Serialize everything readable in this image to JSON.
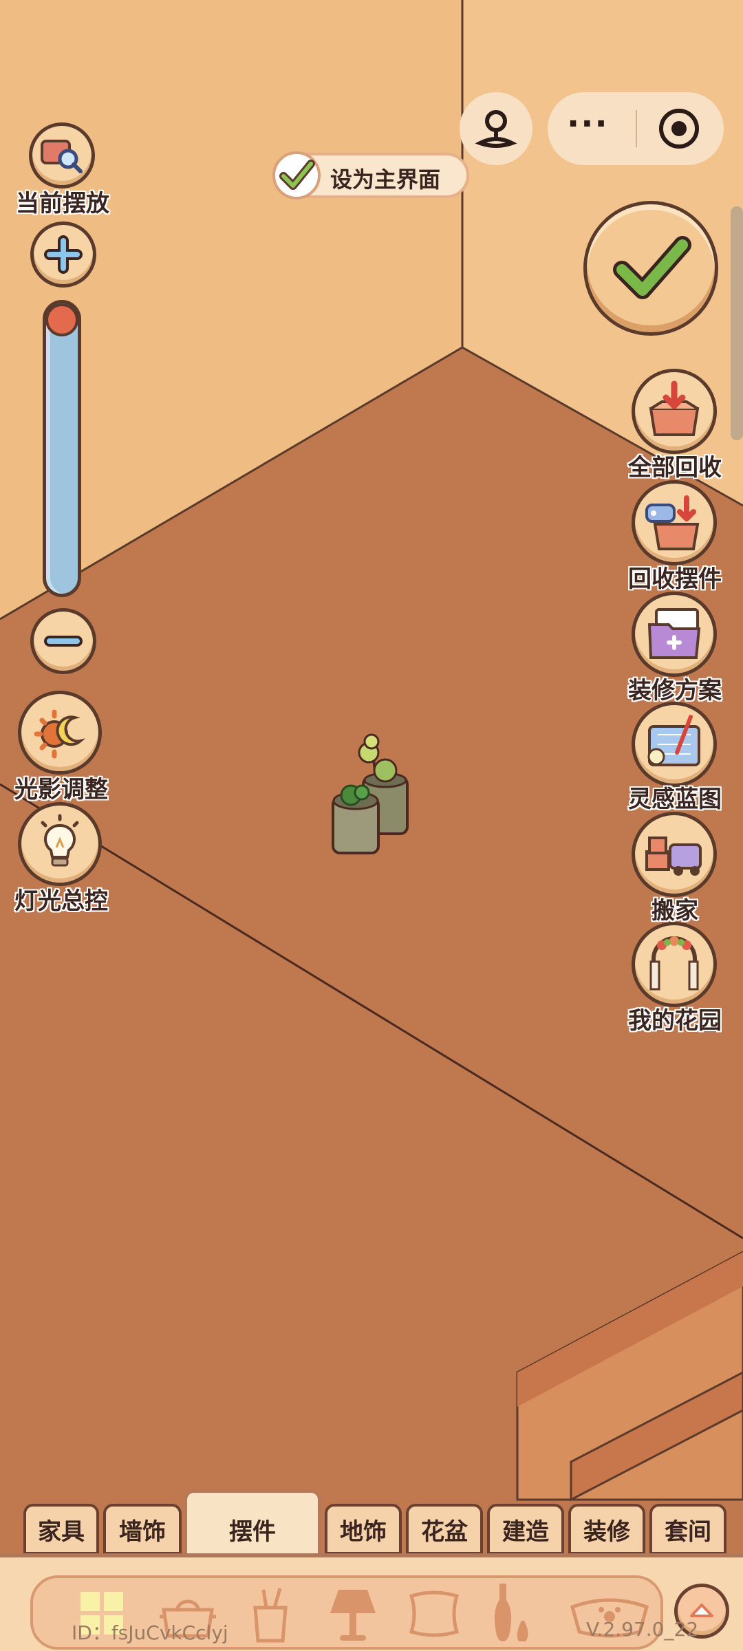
{
  "top": {
    "set_main_label": "设为主界面",
    "more_glyph": "···"
  },
  "left_tools": {
    "current_placement": "当前摆放",
    "lighting_shadow": "光影调整",
    "light_control": "灯光总控",
    "zoom_level": 0.0
  },
  "right_tools": [
    {
      "label": "全部回收",
      "icon": "box-arrow-down-icon"
    },
    {
      "label": "回收摆件",
      "icon": "box-tag-icon"
    },
    {
      "label": "装修方案",
      "icon": "folder-plus-icon"
    },
    {
      "label": "灵感蓝图",
      "icon": "blueprint-icon"
    },
    {
      "label": "搬家",
      "icon": "moving-truck-icon"
    },
    {
      "label": "我的花园",
      "icon": "garden-arch-icon"
    }
  ],
  "tabs": [
    {
      "label": "家具",
      "active": false
    },
    {
      "label": "墙饰",
      "active": false
    },
    {
      "label": "摆件",
      "active": true
    },
    {
      "label": "地饰",
      "active": false
    },
    {
      "label": "花盆",
      "active": false
    },
    {
      "label": "建造",
      "active": false
    },
    {
      "label": "装修",
      "active": false
    },
    {
      "label": "套间",
      "active": false
    }
  ],
  "category_icons": [
    "grid-icon",
    "pot-icon",
    "cup-icon",
    "lamp-icon",
    "cushion-icon",
    "vase-icon",
    "pet-bowl-icon"
  ],
  "footer": {
    "id_text": "ID：fsJuCvkCclyj",
    "version_text": "V.2.97.0_22"
  },
  "colors": {
    "floor": "#c0784e",
    "wall": "#efbd84",
    "confirm_green": "#7ab84a"
  }
}
